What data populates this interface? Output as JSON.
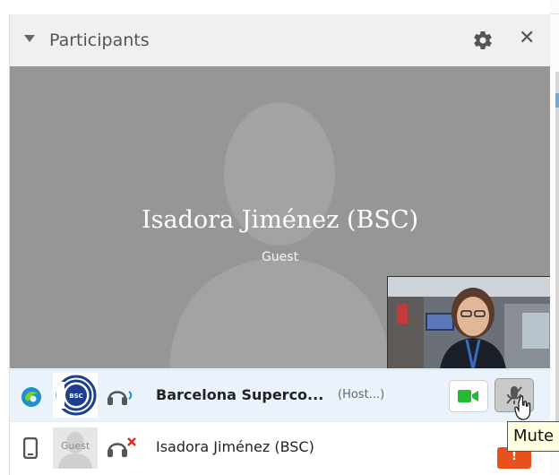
{
  "panel": {
    "title": "Participants",
    "settings_icon": "gear-icon",
    "close_icon": "close-icon",
    "close_glyph": "✕"
  },
  "active_speaker": {
    "name": "Isadora Jiménez (BSC)",
    "role": "Guest"
  },
  "participants": [
    {
      "name": "Barcelona Superco...",
      "tag": "(Host...)",
      "client_icon": "webex-client-icon",
      "avatar_text": "BSC",
      "audio_icon": "headset-audio-icon",
      "video_button_icon": "video-camera-icon",
      "mute_button_icon": "microphone-muted-icon"
    },
    {
      "name": "Isadora Jiménez (BSC)",
      "client_icon": "mobile-phone-icon",
      "avatar_text": "Guest",
      "audio_icon": "headset-disconnected-icon",
      "badge": "!"
    }
  ],
  "tooltip": {
    "text": "Mute"
  },
  "colors": {
    "header_bg": "#f0f0f0",
    "video_bg": "#969696",
    "highlight_row": "#eaf3fb",
    "video_active": "#22bb33",
    "alert": "#e8501e",
    "client_icon": "#1f8fcf"
  }
}
